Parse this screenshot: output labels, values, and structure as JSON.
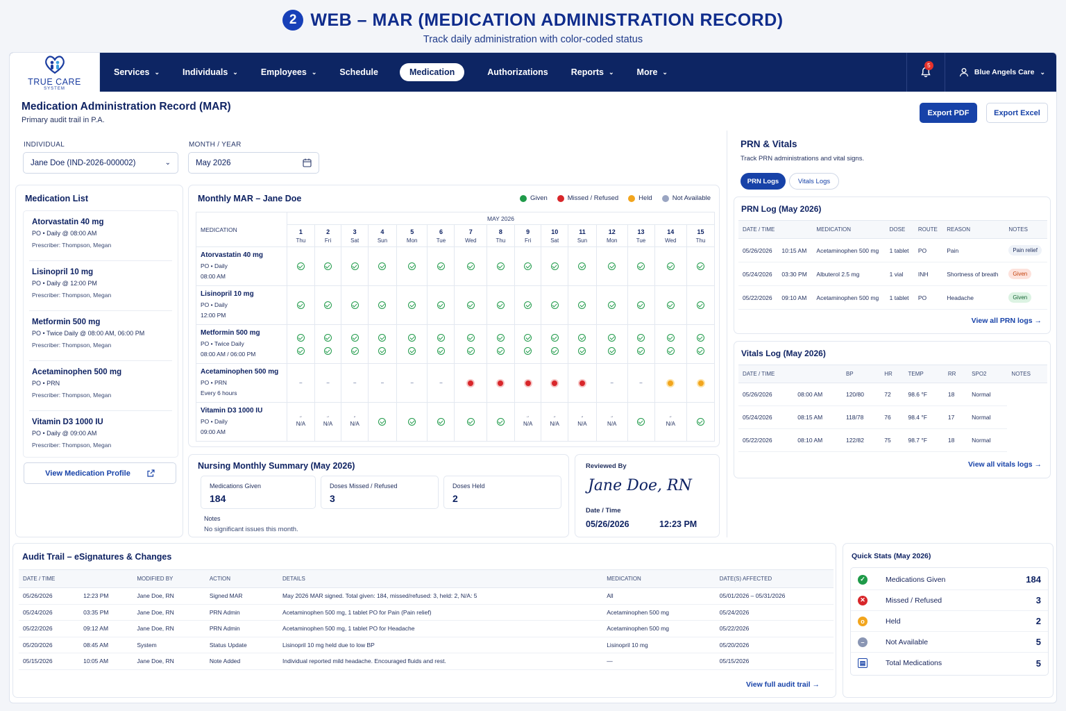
{
  "header": {
    "number": "2",
    "title": "WEB – MAR (MEDICATION ADMINISTRATION RECORD)",
    "subtitle": "Track daily administration with color-coded status"
  },
  "logo": {
    "name": "TRUE CARE",
    "tagline": "SYSTEM"
  },
  "nav": {
    "items": [
      "Services",
      "Individuals",
      "Employees",
      "Schedule",
      "Medication",
      "Authorizations",
      "Reports",
      "More"
    ],
    "active": "Medication",
    "notifications": "5",
    "org": "Blue Angels Care"
  },
  "page": {
    "title": "Medication Administration Record (MAR)",
    "subtitle": "Primary audit trail in P.A.",
    "export_pdf": "Export PDF",
    "export_excel": "Export Excel"
  },
  "filters": {
    "individual_label": "INDIVIDUAL",
    "individual_value": "Jane Doe (IND-2026-000002)",
    "month_label": "MONTH / YEAR",
    "month_value": "May 2026"
  },
  "med_list": {
    "title": "Medication List",
    "items": [
      {
        "name": "Atorvastatin 40 mg",
        "dose": "PO • Daily @ 08:00 AM",
        "prescriber": "Prescriber: Thompson, Megan"
      },
      {
        "name": "Lisinopril 10 mg",
        "dose": "PO • Daily @ 12:00 PM",
        "prescriber": "Prescriber: Thompson, Megan"
      },
      {
        "name": "Metformin 500 mg",
        "dose": "PO • Twice Daily @ 08:00 AM, 06:00 PM",
        "prescriber": "Prescriber: Thompson, Megan"
      },
      {
        "name": "Acetaminophen 500 mg",
        "dose": "PO •  PRN",
        "prescriber": "Prescriber: Thompson, Megan"
      },
      {
        "name": "Vitamin D3 1000 IU",
        "dose": "PO • Daily @ 09:00 AM",
        "prescriber": "Prescriber: Thompson, Megan"
      }
    ],
    "view_profile": "View Medication Profile"
  },
  "mar": {
    "title": "Monthly MAR – Jane Doe",
    "legend": [
      "Given",
      "Missed / Refused",
      "Held",
      "Not Available"
    ],
    "month_header": "MAY 2026",
    "med_col": "MEDICATION",
    "days": [
      {
        "d": "1",
        "w": "Thu"
      },
      {
        "d": "2",
        "w": "Fri"
      },
      {
        "d": "3",
        "w": "Sat"
      },
      {
        "d": "4",
        "w": "Sun"
      },
      {
        "d": "5",
        "w": "Mon"
      },
      {
        "d": "6",
        "w": "Tue"
      },
      {
        "d": "7",
        "w": "Wed"
      },
      {
        "d": "8",
        "w": "Thu"
      },
      {
        "d": "9",
        "w": "Fri"
      },
      {
        "d": "10",
        "w": "Sat"
      },
      {
        "d": "11",
        "w": "Sun"
      },
      {
        "d": "12",
        "w": "Mon"
      },
      {
        "d": "13",
        "w": "Tue"
      },
      {
        "d": "14",
        "w": "Wed"
      },
      {
        "d": "15",
        "w": "Thu"
      }
    ],
    "rows": [
      {
        "name": "Atorvastatin 40 mg",
        "l1": "PO • Daily",
        "l2": "08:00 AM",
        "cells": [
          [
            "g"
          ],
          [
            "g"
          ],
          [
            "g"
          ],
          [
            "g"
          ],
          [
            "g"
          ],
          [
            "g"
          ],
          [
            "g"
          ],
          [
            "g"
          ],
          [
            "g"
          ],
          [
            "g"
          ],
          [
            "g"
          ],
          [
            "g"
          ],
          [
            "g"
          ],
          [
            "g"
          ],
          [
            "g"
          ]
        ]
      },
      {
        "name": "Lisinopril 10 mg",
        "l1": "PO • Daily",
        "l2": "12:00 PM",
        "cells": [
          [
            "g"
          ],
          [
            "g"
          ],
          [
            "g"
          ],
          [
            "g"
          ],
          [
            "g"
          ],
          [
            "g"
          ],
          [
            "g"
          ],
          [
            "g"
          ],
          [
            "g"
          ],
          [
            "g"
          ],
          [
            "g"
          ],
          [
            "g"
          ],
          [
            "g"
          ],
          [
            "g"
          ],
          [
            "g"
          ]
        ]
      },
      {
        "name": "Metformin 500 mg",
        "l1": "PO • Twice Daily",
        "l2": "08:00 AM / 06:00 PM",
        "cells": [
          [
            "g",
            "g"
          ],
          [
            "g",
            "g"
          ],
          [
            "g",
            "g"
          ],
          [
            "g",
            "g"
          ],
          [
            "g",
            "g"
          ],
          [
            "g",
            "g"
          ],
          [
            "g",
            "g"
          ],
          [
            "g",
            "g"
          ],
          [
            "g",
            "g"
          ],
          [
            "g",
            "g"
          ],
          [
            "g",
            "g"
          ],
          [
            "g",
            "g"
          ],
          [
            "g",
            "g"
          ],
          [
            "g",
            "g"
          ],
          [
            "g",
            "g"
          ]
        ]
      },
      {
        "name": "Acetaminophen 500 mg",
        "l1": "PO • PRN",
        "l2": "Every 6 hours",
        "cells": [
          [
            "-"
          ],
          [
            "-"
          ],
          [
            "-"
          ],
          [
            "-"
          ],
          [
            "-"
          ],
          [
            "-"
          ],
          [
            "m"
          ],
          [
            "m"
          ],
          [
            "m"
          ],
          [
            "m"
          ],
          [
            "m"
          ],
          [
            "-"
          ],
          [
            "-"
          ],
          [
            "h"
          ],
          [
            "h"
          ]
        ]
      },
      {
        "name": "Vitamin D3 1000 IU",
        "l1": "PO • Daily",
        "l2": "09:00 AM",
        "cells": [
          [
            "n"
          ],
          [
            "n"
          ],
          [
            "n"
          ],
          [
            "g"
          ],
          [
            "g"
          ],
          [
            "g"
          ],
          [
            "g"
          ],
          [
            "g"
          ],
          [
            "n"
          ],
          [
            "n"
          ],
          [
            "n"
          ],
          [
            "n"
          ],
          [
            "g"
          ],
          [
            "n"
          ],
          [
            "g"
          ]
        ]
      }
    ],
    "na_text": "N/A",
    "dash_text": "–"
  },
  "summary": {
    "title": "Nursing Monthly Summary (May 2026)",
    "given_label": "Medications Given",
    "given": "184",
    "missed_label": "Doses Missed / Refused",
    "missed": "3",
    "held_label": "Doses Held",
    "held": "2",
    "notes_label": "Notes",
    "notes": "No significant issues this month.",
    "reviewed_label": "Reviewed By",
    "reviewer": "Jane Doe, RN",
    "dt_label": "Date / Time",
    "date": "05/26/2026",
    "time": "12:23 PM"
  },
  "prn": {
    "title": "PRN & Vitals",
    "subtitle": "Track PRN administrations and vital signs.",
    "tab1": "PRN Logs",
    "tab2": "Vitals Logs",
    "log_title": "PRN Log (May 2026)",
    "cols": [
      "DATE / TIME",
      "MEDICATION",
      "DOSE",
      "ROUTE",
      "REASON",
      "NOTES"
    ],
    "rows": [
      [
        "05/26/2026",
        "10:15 AM",
        "Acetaminophen 500 mg",
        "1 tablet",
        "PO",
        "Pain",
        "Pain relief"
      ],
      [
        "05/24/2026",
        "03:30 PM",
        "Albuterol 2.5 mg",
        "1 vial",
        "INH",
        "Shortness of breath",
        "Given"
      ],
      [
        "05/22/2026",
        "09:10 AM",
        "Acetaminophen 500 mg",
        "1 tablet",
        "PO",
        "Headache",
        "Given"
      ]
    ],
    "view_all": "View all PRN logs →"
  },
  "vitals": {
    "title": "Vitals Log (May 2026)",
    "cols": [
      "DATE / TIME",
      "BP",
      "HR",
      "TEMP",
      "RR",
      "SPO2",
      "NOTES"
    ],
    "rows": [
      [
        "05/26/2026",
        "08:00 AM",
        "120/80",
        "72",
        "98.6 °F",
        "18",
        "Normal"
      ],
      [
        "05/24/2026",
        "08:15 AM",
        "118/78",
        "76",
        "98.4 °F",
        "17",
        "Normal"
      ],
      [
        "05/22/2026",
        "08:10 AM",
        "122/82",
        "75",
        "98.7 °F",
        "18",
        "Normal"
      ]
    ],
    "view_all": "View all vitals logs →"
  },
  "audit": {
    "title": "Audit Trail – eSignatures & Changes",
    "cols": [
      "DATE / TIME",
      "MODIFIED BY",
      "ACTION",
      "DETAILS",
      "MEDICATION",
      "DATE(S) AFFECTED"
    ],
    "rows": [
      [
        "05/26/2026",
        "12:23 PM",
        "Jane Doe, RN",
        "Signed MAR",
        "May 2026 MAR signed. Total given: 184, missed/refused: 3, held: 2, N/A: 5",
        "All",
        "05/01/2026 – 05/31/2026"
      ],
      [
        "05/24/2026",
        "03:35 PM",
        "Jane Doe, RN",
        "PRN Admin",
        "Acetaminophen 500 mg, 1 tablet PO for Pain (Pain relief)",
        "Acetaminophen 500 mg",
        "05/24/2026"
      ],
      [
        "05/22/2026",
        "09:12 AM",
        "Jane Doe, RN",
        "PRN Admin",
        "Acetaminophen 500 mg, 1 tablet PO for Headache",
        "Acetaminophen 500 mg",
        "05/22/2026"
      ],
      [
        "05/20/2026",
        "08:45 AM",
        "System",
        "Status Update",
        "Lisinopril 10 mg held due to low BP",
        "Lisinopril 10 mg",
        "05/20/2026"
      ],
      [
        "05/15/2026",
        "10:05 AM",
        "Jane Doe, RN",
        "Note Added",
        "Individual reported mild headache. Encouraged fluids and rest.",
        "—",
        "05/15/2026"
      ]
    ],
    "view_all": "View full audit trail →"
  },
  "quick": {
    "title": "Quick Stats (May 2026)",
    "items": [
      {
        "label": "Medications Given",
        "value": "184",
        "color": "#1f9a49",
        "icon": "check-icon"
      },
      {
        "label": "Missed / Refused",
        "value": "3",
        "color": "#d8262a",
        "icon": "x-icon"
      },
      {
        "label": "Held",
        "value": "2",
        "color": "#f2a51d",
        "icon": "pause-icon"
      },
      {
        "label": "Not Available",
        "value": "5",
        "color": "#8a96b4",
        "icon": "minus-icon"
      },
      {
        "label": "Total Medications",
        "value": "5",
        "color": "#1742a8",
        "icon": "clipboard-icon"
      }
    ]
  }
}
